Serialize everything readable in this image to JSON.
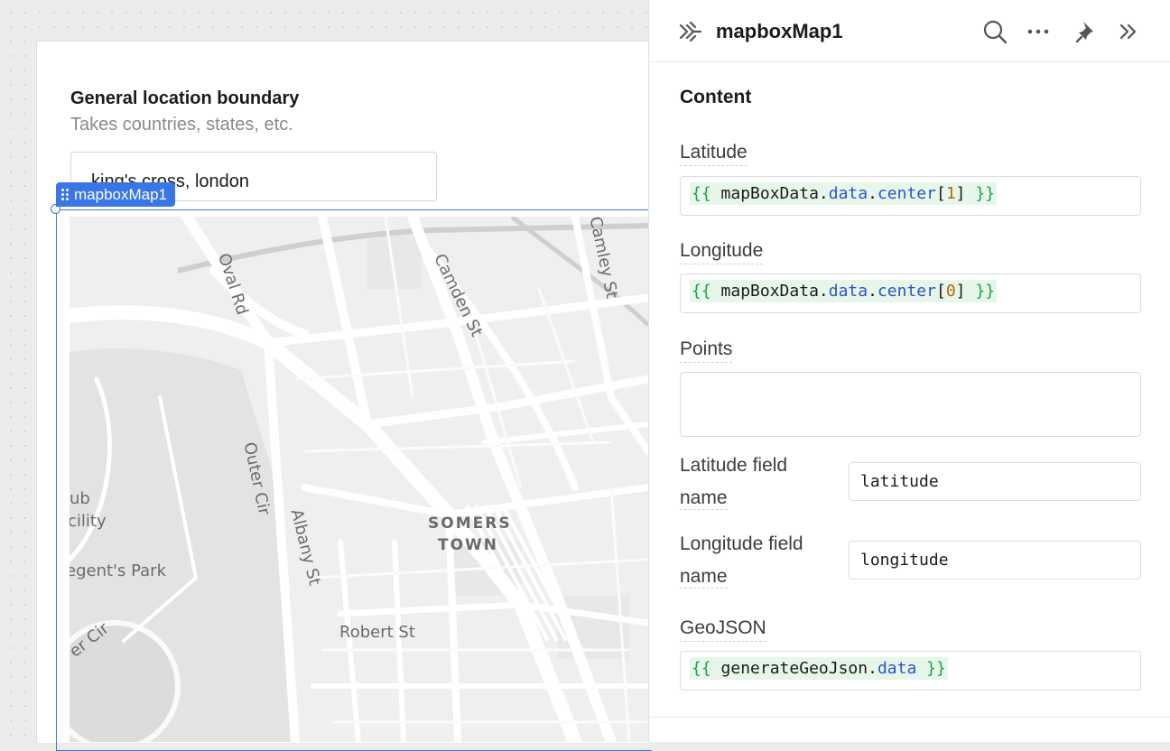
{
  "canvas": {
    "field": {
      "title": "General location boundary",
      "subtitle": "Takes countries, states, etc.",
      "value": "king's cross, london"
    },
    "component_tag": "mapboxMap1",
    "map_labels": {
      "oval_rd": "Oval Rd",
      "camden_st": "Camden St",
      "camley_st": "Camley St",
      "outer_cir_1": "Outer Cir",
      "albany_st": "Albany St",
      "somers": "SOMERS",
      "town": "TOWN",
      "robert_st": "Robert St",
      "regents_park": "egent's Park",
      "hub": "ub",
      "facility": "cility",
      "outer_cir_2": "er Cir"
    }
  },
  "inspector": {
    "title": "mapboxMap1",
    "section": "Content",
    "latitude": {
      "label": "Latitude",
      "code": {
        "open": "{{",
        "obj": "mapBoxData",
        "p1": "data",
        "p2": "center",
        "idx": "1",
        "close": "}}"
      }
    },
    "longitude": {
      "label": "Longitude",
      "code": {
        "open": "{{",
        "obj": "mapBoxData",
        "p1": "data",
        "p2": "center",
        "idx": "0",
        "close": "}}"
      }
    },
    "points": {
      "label": "Points",
      "value": ""
    },
    "latitude_field": {
      "label_1": "Latitude field",
      "label_2": "name",
      "value": "latitude"
    },
    "longitude_field": {
      "label_1": "Longitude field",
      "label_2": "name",
      "value": "longitude"
    },
    "geojson": {
      "label": "GeoJSON",
      "code": {
        "open": "{{",
        "obj": "generateGeoJson",
        "p1": "data",
        "close": "}}"
      }
    }
  },
  "colors": {
    "accent": "#3b76e6",
    "code_brace": "#19a24b",
    "code_prop": "#2e52c9",
    "code_num": "#b26a00"
  },
  "icons": [
    "component-icon",
    "search-icon",
    "more-icon",
    "pin-icon",
    "collapse-icon",
    "drag-handle-icon"
  ]
}
